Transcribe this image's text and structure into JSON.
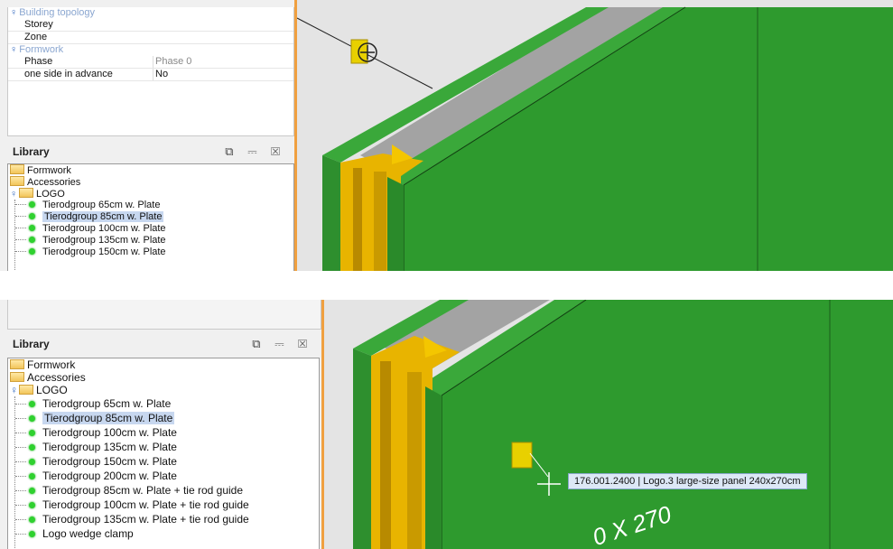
{
  "properties": {
    "group_building": "Building topology",
    "storey_label": "Storey",
    "storey_value": "",
    "zone_label": "Zone",
    "zone_value": "",
    "group_formwork": "Formwork",
    "phase_label": "Phase",
    "phase_value": "Phase 0",
    "side_label": "one side in advance",
    "side_value": "No"
  },
  "library": {
    "title": "Library",
    "controls": "⧉ ⎓ ☒",
    "folders": [
      "Formwork",
      "Accessories",
      "LOGO"
    ],
    "items": [
      "Tierodgroup 65cm w. Plate",
      "Tierodgroup 85cm w. Plate",
      "Tierodgroup 100cm w. Plate",
      "Tierodgroup 135cm w. Plate",
      "Tierodgroup 150cm w. Plate",
      "Tierodgroup 200cm w. Plate",
      "Tierodgroup 85cm w. Plate + tie rod guide",
      "Tierodgroup 100cm w. Plate + tie rod guide",
      "Tierodgroup 135cm w. Plate + tie rod guide",
      "Logo wedge clamp"
    ],
    "selected_item": "Tierodgroup 85cm w. Plate"
  },
  "viewport": {
    "tooltip": "176.001.2400 | Logo.3 large-size panel 240x270cm",
    "panel_label": "0 X 270",
    "colors": {
      "panel_green": "#2e9a2e",
      "panel_dark_green": "#1f7a1f",
      "tierod_yellow": "#e8b400",
      "top_grey": "#a8a8a8",
      "background": "#e4e4e4",
      "accent_orange": "#f0a040"
    }
  }
}
